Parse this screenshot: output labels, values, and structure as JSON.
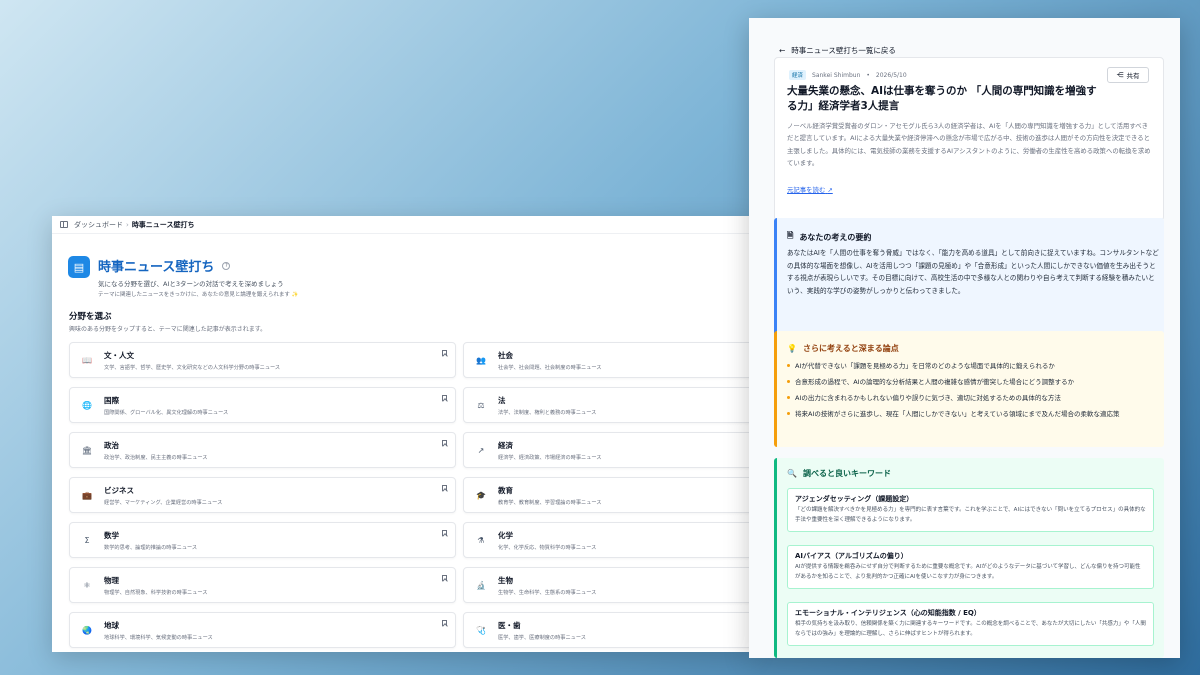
{
  "left": {
    "breadcrumb": {
      "home": "ダッシュボード",
      "current": "時事ニュース壁打ち"
    },
    "app_title": "時事ニュース壁打ち",
    "subtitle": "気になる分野を選び、AIと3ターンの対話で考えを深めましょう",
    "subnote": "テーマに関連したニュースをきっかけに、あなたの意見と論理を鍛えられます ✨",
    "section_title": "分野を選ぶ",
    "section_desc": "興味のある分野をタップすると、テーマに関連した記事が表示されます。",
    "categories": [
      {
        "name": "文・人文",
        "desc": "文学、言語学、哲学、歴史学、文化研究などの人文科学分野の時事ニュース",
        "icon": "book-icon",
        "glyph": "📖"
      },
      {
        "name": "社会",
        "desc": "社会学、社会問題、社会制度の時事ニュース",
        "icon": "people-icon",
        "glyph": "👥"
      },
      {
        "name": "国際",
        "desc": "国際関係、グローバル化、異文化理解の時事ニュース",
        "icon": "globe-icon",
        "glyph": "🌐"
      },
      {
        "name": "法",
        "desc": "法学、法制度、権利と義務の時事ニュース",
        "icon": "scale-icon",
        "glyph": "⚖"
      },
      {
        "name": "政治",
        "desc": "政治学、政治制度、民主主義の時事ニュース",
        "icon": "building-icon",
        "glyph": "🏛"
      },
      {
        "name": "経済",
        "desc": "経済学、経済政策、市場経済の時事ニュース",
        "icon": "trend-icon",
        "glyph": "↗"
      },
      {
        "name": "ビジネス",
        "desc": "経営学、マーケティング、企業経営の時事ニュース",
        "icon": "briefcase-icon",
        "glyph": "💼"
      },
      {
        "name": "教育",
        "desc": "教育学、教育制度、学習理論の時事ニュース",
        "icon": "graduation-icon",
        "glyph": "🎓"
      },
      {
        "name": "数学",
        "desc": "数学的思考、論理的推論の時事ニュース",
        "icon": "sigma-icon",
        "glyph": "Σ"
      },
      {
        "name": "化学",
        "desc": "化学、化学反応、物質科学の時事ニュース",
        "icon": "flask-icon",
        "glyph": "⚗"
      },
      {
        "name": "物理",
        "desc": "物理学、自然現象、科学技術の時事ニュース",
        "icon": "atom-icon",
        "glyph": "⚛"
      },
      {
        "name": "生物",
        "desc": "生物学、生命科学、生態系の時事ニュース",
        "icon": "microscope-icon",
        "glyph": "🔬"
      },
      {
        "name": "地球",
        "desc": "地球科学、環境科学、気候変動の時事ニュース",
        "icon": "earth-icon",
        "glyph": "🌏"
      },
      {
        "name": "医・歯",
        "desc": "医学、歯学、医療制度の時事ニュース",
        "icon": "stethoscope-icon",
        "glyph": "🩺"
      }
    ]
  },
  "right": {
    "back_label": "時事ニュース壁打ち一覧に戻る",
    "article": {
      "tag": "経済",
      "source": "Sankei Shimbun",
      "date": "2026/5/10",
      "share_label": "共有",
      "title": "大量失業の懸念、AIは仕事を奪うのか 「人間の専門知識を増強する力」経済学者3人提言",
      "body": "ノーベル経済学賞受賞者のダロン・アセモグル氏ら3人の経済学者は、AIを「人間の専門知識を増強する力」として活用すべきだと提言しています。AIによる大量失業や経済停滞への懸念が市場で広がる中、技術の進歩は人間がその方向性を決定できると主張しました。具体的には、電気技師の業務を支援するAIアシスタントのように、労働者の生産性を高める政策への転換を求めています。",
      "link_label": "元記事を読む"
    },
    "summary": {
      "title": "あなたの考えの要約",
      "text": "あなたはAIを「人間の仕事を奪う脅威」ではなく、「能力を高める道具」として前向きに捉えていますね。コンサルタントなどの具体的な場面を想像し、AIを活用しつつ「課題の見極め」や「合意形成」といった人間にしかできない価値を生み出そうとする視点が表現らしいです。その目標に向けて、高校生活の中で多様な人との関わりや自ら考えて判断する経験を積みたいという、実践的な学びの姿勢がしっかりと伝わってきました。"
    },
    "points": {
      "title": "さらに考えると深まる論点",
      "items": [
        "AIが代替できない「課題を見極める力」を日常のどのような場面で具体的に鍛えられるか",
        "合意形成の過程で、AIの論理的な分析結果と人間の複雑な感情が衝突した場合にどう調整するか",
        "AIの出力に含まれるかもしれない偏りや誤りに気づき、適切に対処するための具体的な方法",
        "将来AIの技術がさらに進歩し、現在「人間にしかできない」と考えている領域にまで及んだ場合の柔軟な適応策"
      ]
    },
    "keywords": {
      "title": "調べると良いキーワード",
      "items": [
        {
          "term": "アジェンダセッティング（課題設定）",
          "desc": "「どの課題を解決すべきかを見極める力」を専門的に表す言葉です。これを学ぶことで、AIにはできない「問いを立てるプロセス」の具体的な手法や重要性を深く理解できるようになります。"
        },
        {
          "term": "AIバイアス（アルゴリズムの偏り）",
          "desc": "AIが提供する情報を鵜呑みにせず自分で判断するために重要な概念です。AIがどのようなデータに基づいて学習し、どんな偏りを持つ可能性があるかを知ることで、より批判的かつ正確にAIを使いこなす力が身につきます。"
        },
        {
          "term": "エモーショナル・インテリジェンス（心の知能指数 / EQ）",
          "desc": "相手の気持ちを汲み取り、信頼関係を築く力に関連するキーワードです。この概念を調べることで、あなたが大切にしたい「共感力」や「人間ならではの強み」を理論的に理解し、さらに伸ばすヒントが得られます。"
        }
      ]
    }
  }
}
